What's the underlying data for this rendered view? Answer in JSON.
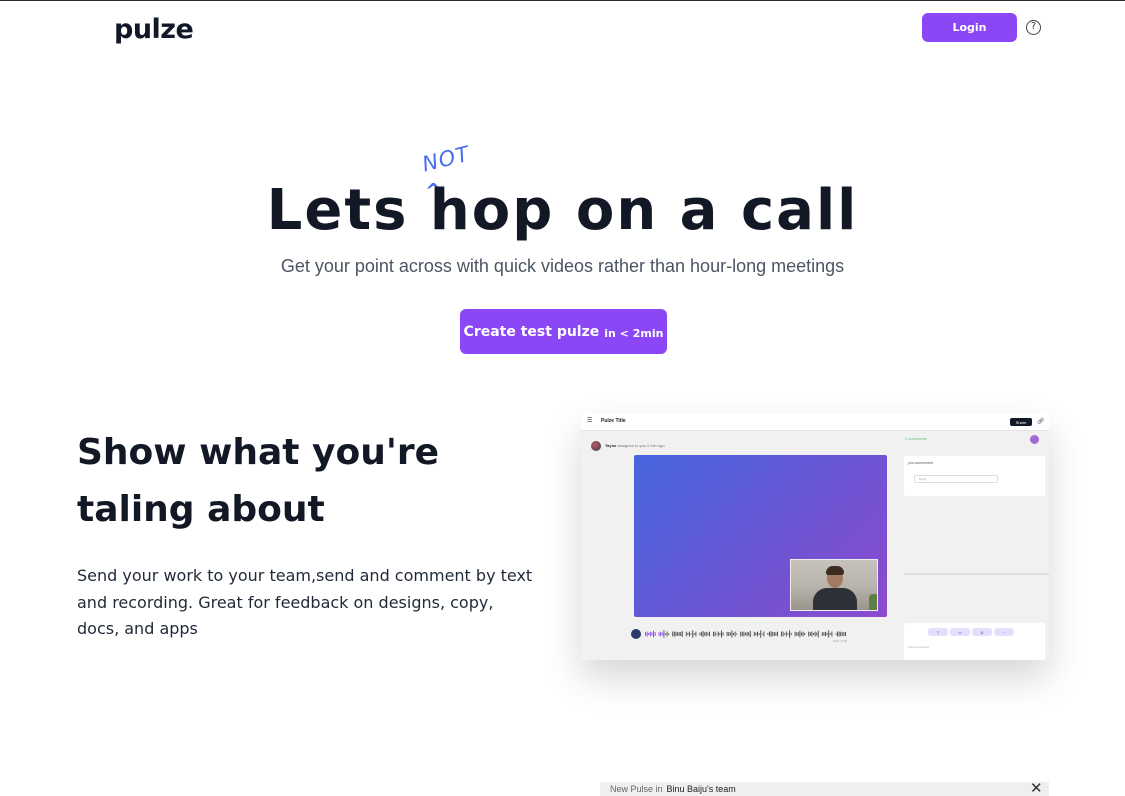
{
  "header": {
    "logo": "pulze",
    "login_label": "Login",
    "help_icon": "?"
  },
  "hero": {
    "title_lets": "Lets",
    "title_rest": "hop on a call",
    "annotation": "NOT",
    "caret": "^",
    "subtitle": "Get your point across with quick videos rather than hour-long meetings",
    "cta_main": "Create test pulze",
    "cta_small": "in < 2min"
  },
  "feature": {
    "title": "Show what you're taling about",
    "description": "Send your work to your team,send and comment by text and recording. Great for feedback on designs, copy, docs, and apps"
  },
  "mockup": {
    "title": "Pulze Title",
    "share_label": "Share",
    "user_name": "Taylor",
    "user_meta": "assigned to you 2 min ago",
    "sidebar_status": "2 comments",
    "comment_author": "you commented",
    "reply_placeholder": "Reply",
    "compose_placeholder": "Add a comment",
    "chips": [
      "T",
      "▭",
      "◘",
      "⋯"
    ],
    "duration": "0:00 / 2:45"
  },
  "bottom_bar": {
    "prefix": "New Pulse in",
    "team": "Binu Baiju's team",
    "close_icon": "✕"
  },
  "colors": {
    "accent": "#8b47f6",
    "annotation": "#4a6df0",
    "heading": "#121826"
  }
}
